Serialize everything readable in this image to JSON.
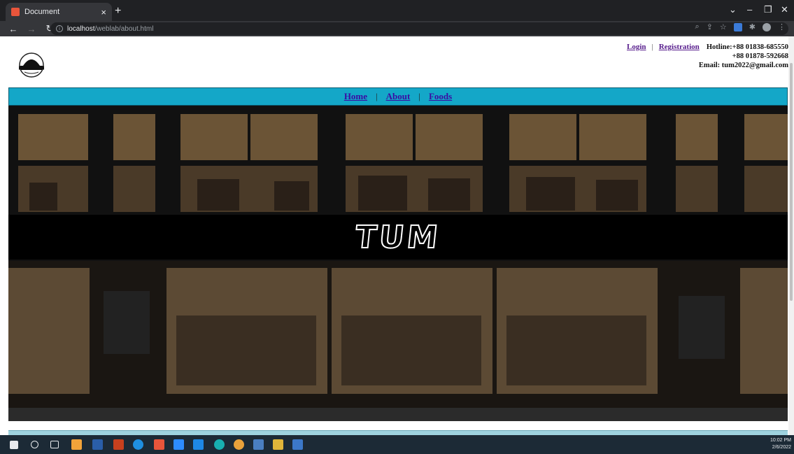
{
  "browser": {
    "tab_title": "Document",
    "tab_close": "×",
    "new_tab": "+",
    "url_host": "localhost",
    "url_path": "/weblab/about.html",
    "controls": {
      "minimize": "–",
      "maximize": "❐",
      "close": "✕",
      "dropdown": "⌄"
    }
  },
  "header": {
    "login": "Login",
    "separator": "|",
    "registration": "Registration",
    "hotline_line1": "Hotline:+88 01838-685550",
    "hotline_line2": "+88 01878-592668",
    "email": "Email: tum2022@gmail.com"
  },
  "nav": {
    "items": [
      {
        "label": "Home"
      },
      {
        "label": "About"
      },
      {
        "label": "Foods"
      }
    ],
    "separator": "|"
  },
  "hero": {
    "brand": "TUM"
  },
  "taskbar": {
    "time": "10:02 PM",
    "date": "2/6/2022"
  },
  "colors": {
    "navbar": "#14a7c8",
    "link": "#551a8b",
    "chrome": "#202124"
  }
}
